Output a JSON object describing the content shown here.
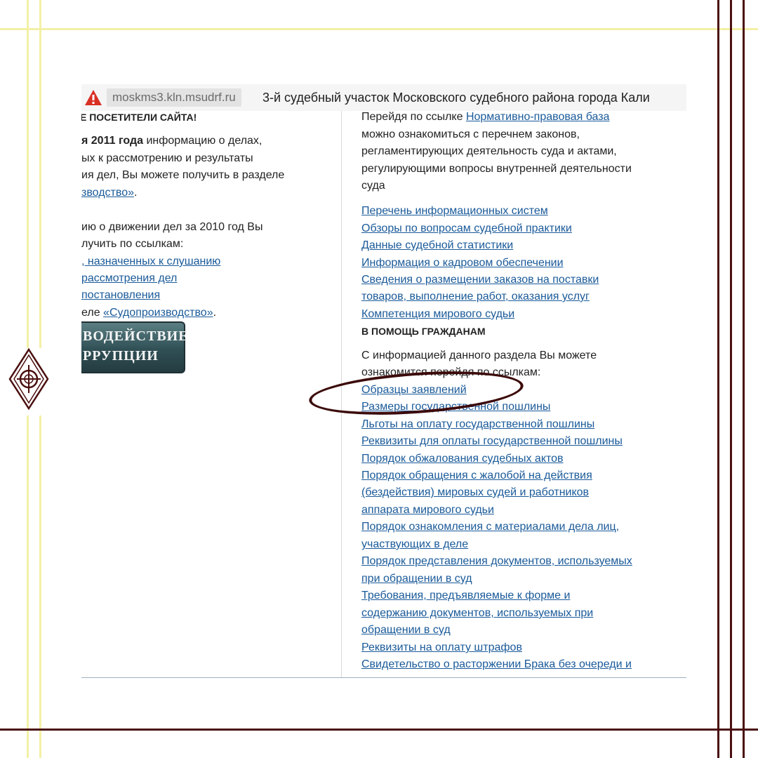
{
  "browser": {
    "url_host": "moskms3.kln.msudrf.ru",
    "tab_title": "3-й судебный участок Московского судебного района города Кали"
  },
  "left": {
    "heading_fragment": "Е ПОСЕТИТЕЛИ САЙТА!",
    "para1_bold": "я 2011 года",
    "para1_l1_rest": " информацию о делах,",
    "para1_l2": "ых к рассмотрению и результаты",
    "para1_l3": "ия дел, Вы можете получить в разделе",
    "para1_l4_link": "зводство»",
    "para1_l4_tail": ".",
    "para2_l1": "ию о движении дел за 2010 год Вы",
    "para2_l2": "лучить по ссылкам:",
    "link_a": ", назначенных к слушанию",
    "link_b": " рассмотрения дел",
    "link_c": "постановления",
    "para2_last_prefix": "еле ",
    "para2_last_link": "«Судопроизводство»",
    "para2_last_tail": ".",
    "banner_line1": "ВОДЕЙСТВИЕ",
    "banner_line2": "РРУПЦИИ"
  },
  "right": {
    "intro_prefix": "Перейдя по ссылке ",
    "intro_link": "Нормативно-правовая база",
    "intro_l2": "можно ознакомиться с перечнем законов,",
    "intro_l3": "регламентирующих деятельность суда и актами,",
    "intro_l4": "регулирующими вопросы внутренней деятельности",
    "intro_l5": "суда",
    "links1": [
      "Перечень информационных систем",
      "Обзоры по вопросам судебной практики",
      "Данные судебной статистики",
      "Информация о кадровом обеспечении",
      "Сведения о размещении заказов на поставки",
      "товаров, выполнение работ, оказания услуг",
      "Компетенция мирового судьи"
    ],
    "section_heading": "В ПОМОЩЬ ГРАЖДАНАМ",
    "help_l1": "С информацией данного раздела Вы можете",
    "help_l2": "ознакомится перейдя по ссылкам:",
    "links2": [
      "Образцы заявлений",
      "Размеры государственной пошлины",
      "Льготы на оплату государственной пошлины",
      "Реквизиты для оплаты государственной пошлины",
      "Порядок обжалования судебных актов",
      "Порядок обращения с жалобой на действия",
      "(бездействия) мировых судей и работников",
      "аппарата мирового судьи",
      "Порядок ознакомления с материалами дела лиц,",
      "участвующих в деле",
      "Порядок представления документов, используемых",
      "при обращении в суд",
      "Требования, предъявляемые к форме и",
      "содержанию документов, используемых при",
      "обращении в суд",
      "Реквизиты на оплату штрафов",
      "Свидетельство о расторжении Брака без очереди и"
    ]
  },
  "colors": {
    "frame_yellow": "#f3f0a6",
    "frame_brown": "#4a0f0f",
    "link_blue": "#1a5a99",
    "highlight_ring": "#3c0a0a"
  }
}
